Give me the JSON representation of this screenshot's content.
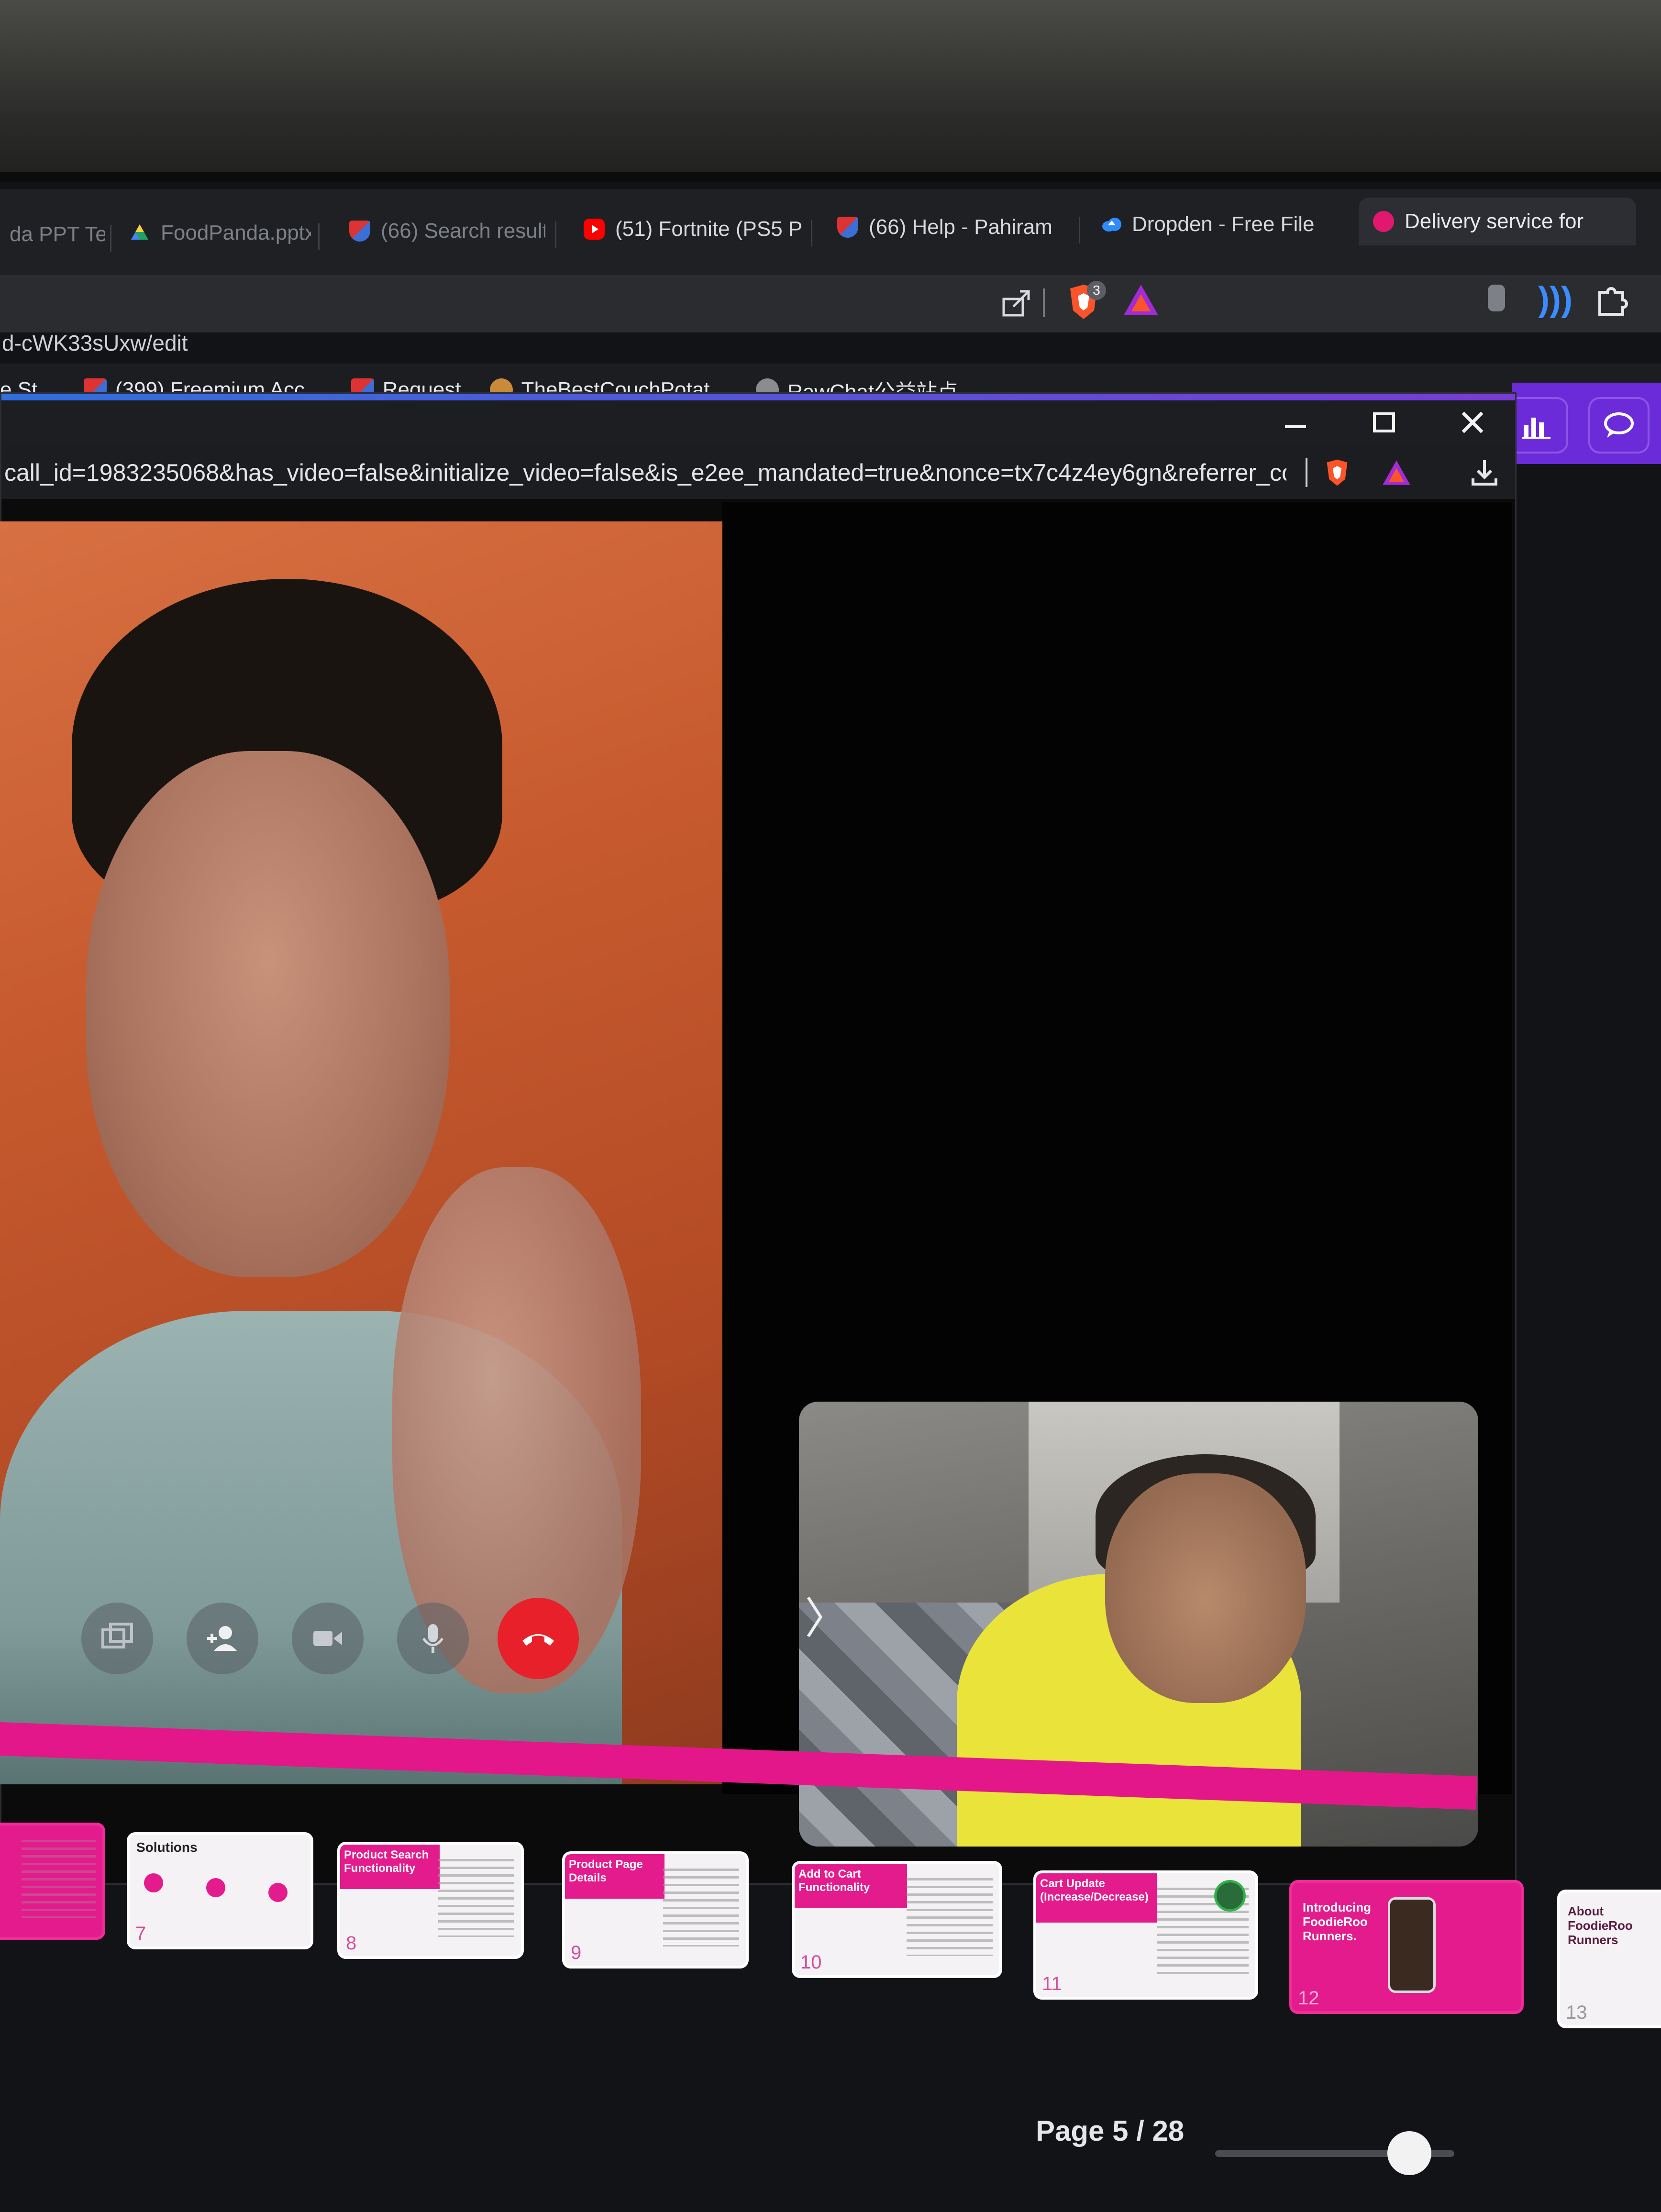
{
  "browser": {
    "tabs": [
      {
        "label": "da PPT Te",
        "favicon": "slides",
        "color": "#f4b400",
        "state": "dim"
      },
      {
        "label": "FoodPanda.pptx",
        "favicon": "google-drive",
        "color": "#1fa463",
        "state": "dim"
      },
      {
        "label": "(66) Search results",
        "favicon": "shield",
        "color": "#3b6fd6",
        "state": "dim"
      },
      {
        "label": "(51) Fortnite (PS5 P",
        "favicon": "youtube",
        "color": "#ff0000",
        "state": "normal"
      },
      {
        "label": "(66) Help - Pahiram",
        "favicon": "shield",
        "color": "#3b6fd6",
        "state": "normal"
      },
      {
        "label": "Dropden - Free File",
        "favicon": "cloud",
        "color": "#2f8cff",
        "state": "normal"
      },
      {
        "label": "Delivery service for",
        "favicon": "foodpanda",
        "color": "#e2186f",
        "state": "active"
      }
    ],
    "address_fragment": "d-cWK33sUxw/edit",
    "brave_badge": "3",
    "bookmarks": [
      {
        "label": "e St...",
        "favicon": "generic"
      },
      {
        "label": "(399) Freemium Acc...",
        "favicon": "shield"
      },
      {
        "label": "Request",
        "favicon": "shield"
      },
      {
        "label": "TheBestCouchPotat...",
        "favicon": "emoji"
      },
      {
        "label": "RawChat公益站点",
        "favicon": "openai"
      }
    ]
  },
  "popup": {
    "url": "call_id=1983235068&has_video=false&initialize_video=false&is_e2ee_mandated=true&nonce=tx7c4z4ey6gn&referrer_conte...",
    "window_buttons": [
      "minimize",
      "maximize",
      "close"
    ]
  },
  "call": {
    "controls": [
      "share-screen",
      "add-person",
      "video-camera",
      "microphone",
      "end-call"
    ],
    "end_call_color": "#e8202a",
    "collapse_glyph": "〉"
  },
  "filmstrip": {
    "slides": [
      {
        "num": "",
        "title": "",
        "style": "pink"
      },
      {
        "num": "7",
        "title": "Solutions",
        "style": "light"
      },
      {
        "num": "8",
        "title": "Product Search Functionality",
        "style": "header"
      },
      {
        "num": "9",
        "title": "Product Page Details",
        "style": "header"
      },
      {
        "num": "10",
        "title": "Add to Cart Functionality",
        "style": "header"
      },
      {
        "num": "11",
        "title": "Cart Update (Increase/Decrease)",
        "style": "header"
      },
      {
        "num": "12",
        "title": "Introducing FoodieRoo Runners.",
        "style": "pink"
      },
      {
        "num": "13",
        "title": "About FoodieRoo Runners",
        "style": "light"
      }
    ],
    "page_label": "Page 5 / 28",
    "zoom_level": 0.72
  },
  "colors": {
    "brand_pink": "#e41b8c",
    "app_purple": "#6c2bd9",
    "brave_orange": "#fb542b"
  }
}
